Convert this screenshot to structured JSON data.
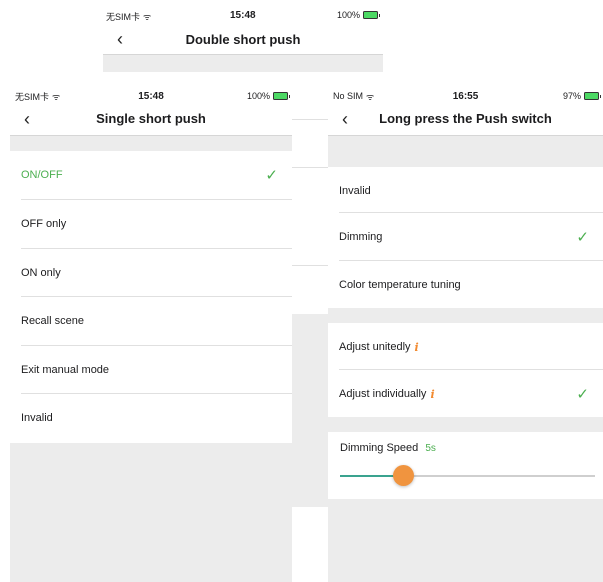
{
  "background_screen": {
    "status": {
      "carrier": "无SIM卡",
      "time": "15:48",
      "battery": "100%"
    },
    "title": "Double short push"
  },
  "left_screen": {
    "status": {
      "carrier": "无SIM卡",
      "time": "15:48",
      "battery": "100%"
    },
    "title": "Single short push",
    "options": [
      {
        "label": "ON/OFF",
        "selected": true
      },
      {
        "label": "OFF only",
        "selected": false
      },
      {
        "label": "ON only",
        "selected": false
      },
      {
        "label": "Recall scene",
        "selected": false
      },
      {
        "label": "Exit manual mode",
        "selected": false
      },
      {
        "label": "Invalid",
        "selected": false
      }
    ]
  },
  "right_screen": {
    "status": {
      "carrier": "No SIM",
      "time": "16:55",
      "battery": "97%"
    },
    "title": "Long press the Push switch",
    "modes": [
      {
        "label": "Invalid",
        "selected": false
      },
      {
        "label": "Dimming",
        "selected": true
      },
      {
        "label": "Color temperature tuning",
        "selected": false
      }
    ],
    "adjust": [
      {
        "label": "Adjust unitedly",
        "info": "i",
        "selected": false
      },
      {
        "label": "Adjust individually",
        "info": "i",
        "selected": true
      }
    ],
    "speed": {
      "label": "Dimming Speed",
      "value": "5s",
      "level": 0.25
    }
  },
  "colors": {
    "accent_green": "#4caf50",
    "slider_thumb": "#f0943f",
    "slider_fill": "#3aa38f",
    "info_orange": "#f28a30"
  },
  "icons": {
    "check": "✓",
    "back": "‹"
  }
}
